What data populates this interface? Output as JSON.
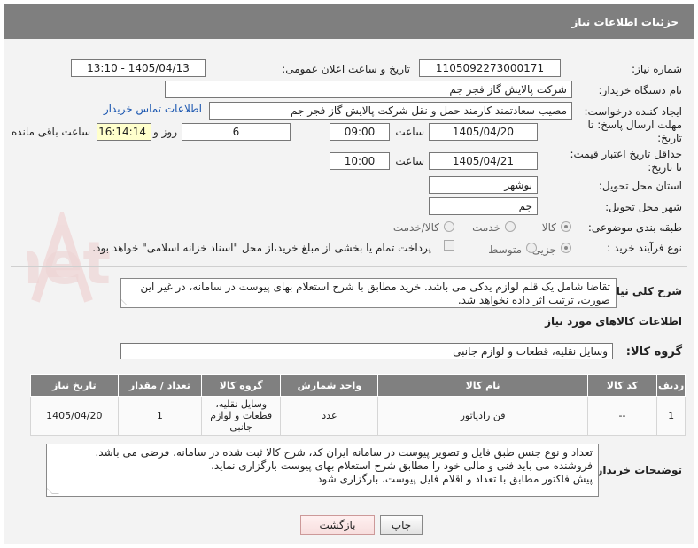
{
  "header": {
    "title": "جزئیات اطلاعات نیاز"
  },
  "form": {
    "need_number": {
      "label": "شماره نیاز:",
      "value": "1105092273000171"
    },
    "announce_datetime": {
      "label": "تاریخ و ساعت اعلان عمومی:",
      "value": "1405/04/13 - 13:10"
    },
    "buyer_org": {
      "label": "نام دستگاه خریدار:",
      "value": "شرکت پالایش گاز فجر جم"
    },
    "requester": {
      "label": "ایجاد کننده درخواست:",
      "value": "مصیب سعادتمند کارمند حمل و نقل شرکت پالایش گاز فجر جم",
      "contact_link": "اطلاعات تماس خریدار"
    },
    "reply_deadline": {
      "label": "مهلت ارسال پاسخ: تا تاریخ:",
      "date": "1405/04/20",
      "time_label": "ساعت",
      "time": "09:00",
      "days": "6",
      "days_label": "روز و",
      "remaining": "16:14:14",
      "remaining_label": "ساعت باقی مانده"
    },
    "price_validity": {
      "label": "حداقل تاریخ اعتبار قیمت: تا تاریخ:",
      "date": "1405/04/21",
      "time_label": "ساعت",
      "time": "10:00"
    },
    "province": {
      "label": "استان محل تحویل:",
      "value": "بوشهر"
    },
    "city": {
      "label": "شهر محل تحویل:",
      "value": "جم"
    },
    "category": {
      "label": "طبقه بندی موضوعی:",
      "options": [
        "کالا",
        "خدمت",
        "کالا/خدمت"
      ],
      "selected": "کالا"
    },
    "purchase_process": {
      "label": "نوع فرآیند خرید :",
      "options": [
        "جزیی",
        "متوسط"
      ],
      "selected": "جزیی",
      "payment_note": "پرداخت تمام یا بخشی از مبلغ خرید،از محل \"اسناد خزانه اسلامی\" خواهد بود."
    }
  },
  "general_description": {
    "label": "شرح کلی نیاز:",
    "text": "تقاضا شامل یک قلم لوازم یدکی می باشد. خرید مطابق با شرح استعلام بهای پیوست در سامانه، در غیر این صورت، ترتیب اثر داده نخواهد شد."
  },
  "goods_info": {
    "section_title": "اطلاعات کالاهای مورد نیاز",
    "group_label": "گروه کالا:",
    "group_value": "وسایل نقلیه، قطعات و لوازم جانبی",
    "columns": [
      "ردیف",
      "کد کالا",
      "نام کالا",
      "واحد شمارش",
      "گروه کالا",
      "تعداد / مقدار",
      "تاریخ نیاز"
    ],
    "rows": [
      {
        "row": "1",
        "code": "--",
        "name": "فن رادیاتور",
        "unit": "عدد",
        "group": "وسایل نقلیه، قطعات و لوازم جانبی",
        "qty": "1",
        "date": "1405/04/20"
      }
    ]
  },
  "buyer_notes": {
    "label": "توضیحات خریدار:",
    "lines": [
      "تعداد و نوع جنس طبق فایل و تصویر پیوست در سامانه ایران کد، شرح کالا ثبت شده در سامانه، فرضی می باشد.",
      "فروشنده می باید فنی و مالی خود را مطابق شرح استعلام بهای پیوست بارگزاری نماید.",
      "پیش فاکتور مطابق با تعداد و اقلام فایل پیوست، بارگزاری شود"
    ]
  },
  "buttons": {
    "print": "چاپ",
    "back": "بازگشت"
  },
  "colors": {
    "header_bg": "#7f7f7f",
    "watermark": "#e8b9b9",
    "link": "#1a56b0"
  }
}
